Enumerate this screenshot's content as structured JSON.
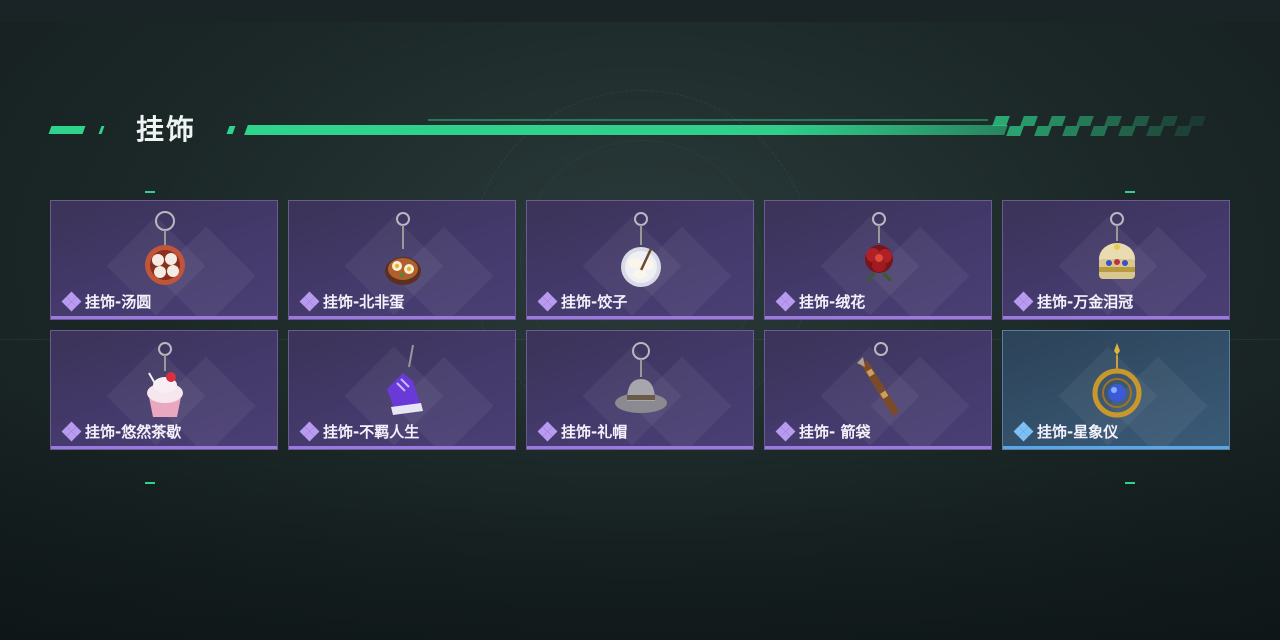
{
  "section": {
    "title": "挂饰"
  },
  "colors": {
    "accent": "#2fd48c",
    "purple_card": "#43396a",
    "purple_edge": "#9b7ae0",
    "blue_card": "#34506a",
    "blue_edge": "#58a8e8"
  },
  "items": [
    {
      "label": "挂饰-汤圆",
      "icon": "tangyuan-bowl-icon",
      "rarity": "purple"
    },
    {
      "label": "挂饰-北非蛋",
      "icon": "shakshuka-pan-icon",
      "rarity": "purple"
    },
    {
      "label": "挂饰-饺子",
      "icon": "dumpling-plate-icon",
      "rarity": "purple"
    },
    {
      "label": "挂饰-绒花",
      "icon": "velvet-flower-icon",
      "rarity": "purple"
    },
    {
      "label": "挂饰-万金泪冠",
      "icon": "jeweled-crown-icon",
      "rarity": "purple"
    },
    {
      "label": "挂饰-悠然茶歇",
      "icon": "cupcake-icon",
      "rarity": "purple"
    },
    {
      "label": "挂饰-不羁人生",
      "icon": "sneaker-icon",
      "rarity": "purple"
    },
    {
      "label": "挂饰-礼帽",
      "icon": "fedora-hat-icon",
      "rarity": "purple"
    },
    {
      "label": "挂饰- 箭袋",
      "icon": "quiver-icon",
      "rarity": "purple"
    },
    {
      "label": "挂饰-星象仪",
      "icon": "astrolabe-icon",
      "rarity": "blue"
    }
  ]
}
